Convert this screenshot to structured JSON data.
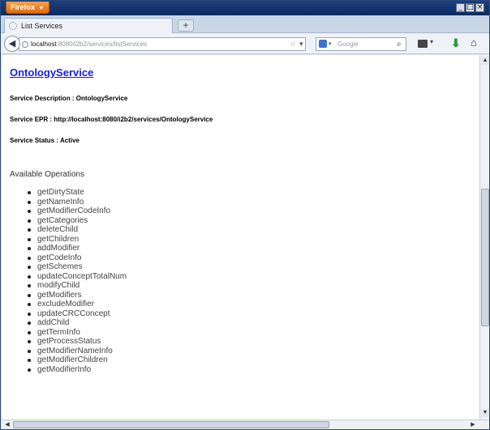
{
  "browser": {
    "menu_button": "Firefox",
    "menu_caret": "▼",
    "window_controls": {
      "minimize": "_",
      "maximize": "□",
      "close": "×"
    }
  },
  "tabs": [
    {
      "label": "List Services",
      "icon": "globe-icon"
    }
  ],
  "new_tab_label": "+",
  "navbar": {
    "back_glyph": "◀",
    "url_host": "localhost",
    "url_rest": ":8080/i2b2/services/listServices",
    "star_glyph": "☆",
    "reload_glyph": "▾ C",
    "search_placeholder": "Google",
    "search_caret": "▾",
    "search_glyph": "⌕",
    "bookmark_caret": "▾",
    "download_glyph": "⬇",
    "home_glyph": "⌂"
  },
  "page": {
    "service_name": "OntologyService",
    "description": "Service Description : OntologyService",
    "epr": "Service EPR : http://localhost:8080/i2b2/services/OntologyService",
    "status": "Service Status : Active",
    "operations_heading": "Available Operations",
    "operations": [
      "getDirtyState",
      "getNameInfo",
      "getModifierCodeInfo",
      "getCategories",
      "deleteChild",
      "getChildren",
      "addModifier",
      "getCodeInfo",
      "getSchemes",
      "updateConceptTotalNum",
      "modifyChild",
      "getModifiers",
      "excludeModifier",
      "updateCRCConcept",
      "addChild",
      "getTermInfo",
      "getProcessStatus",
      "getModifierNameInfo",
      "getModifierChildren",
      "getModifierInfo"
    ]
  },
  "scrollbars": {
    "up": "▲",
    "down": "▼",
    "left": "◀",
    "right": "▶"
  }
}
